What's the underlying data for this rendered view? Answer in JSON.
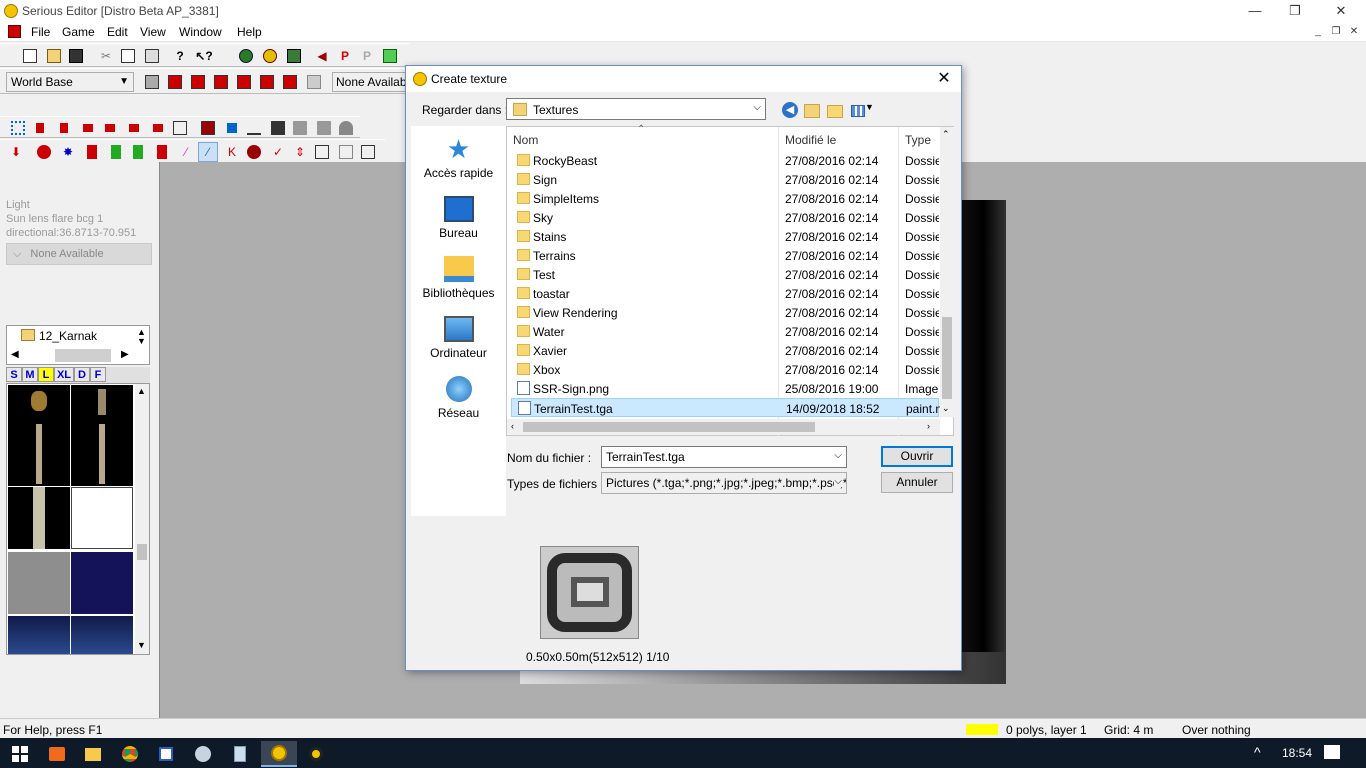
{
  "window": {
    "title": "Serious Editor [Distro Beta AP_3381]",
    "min": "—",
    "restore": "❐",
    "close": "✕"
  },
  "menu": {
    "items": [
      "File",
      "Game",
      "Edit",
      "View",
      "Window",
      "Help"
    ],
    "mdi_min": "_",
    "mdi_restore": "❐",
    "mdi_close": "✕"
  },
  "toolbar": {
    "world_base": "World Base",
    "none_available": "None Availabl"
  },
  "left_panel": {
    "line1": "Light",
    "line2": "Sun lens flare bcg 1",
    "line3": "directional:36.8713-70.951",
    "dropdown": "None Available",
    "tree_item": "12_Karnak",
    "tex_buttons": [
      "S",
      "M",
      "L",
      "XL",
      "D",
      "F"
    ]
  },
  "status_bar": {
    "help": "For Help, press F1",
    "polys": "0 polys, layer 1",
    "grid": "Grid: 4 m",
    "over": "Over nothing"
  },
  "taskbar": {
    "time": "18:54",
    "tray_up": "^"
  },
  "dialog": {
    "title": "Create texture",
    "close": "✕",
    "look_in_label": "Regarder dans :",
    "look_in_value": "Textures",
    "places": [
      "Accès rapide",
      "Bureau",
      "Bibliothèques",
      "Ordinateur",
      "Réseau"
    ],
    "columns": {
      "name": "Nom",
      "modified": "Modifié le",
      "type": "Type"
    },
    "files": [
      {
        "name": "RockyBeast",
        "date": "27/08/2016 02:14",
        "type": "Dossie",
        "kind": "folder"
      },
      {
        "name": "Sign",
        "date": "27/08/2016 02:14",
        "type": "Dossie",
        "kind": "folder"
      },
      {
        "name": "SimpleItems",
        "date": "27/08/2016 02:14",
        "type": "Dossie",
        "kind": "folder"
      },
      {
        "name": "Sky",
        "date": "27/08/2016 02:14",
        "type": "Dossie",
        "kind": "folder"
      },
      {
        "name": "Stains",
        "date": "27/08/2016 02:14",
        "type": "Dossie",
        "kind": "folder"
      },
      {
        "name": "Terrains",
        "date": "27/08/2016 02:14",
        "type": "Dossie",
        "kind": "folder"
      },
      {
        "name": "Test",
        "date": "27/08/2016 02:14",
        "type": "Dossie",
        "kind": "folder"
      },
      {
        "name": "toastar",
        "date": "27/08/2016 02:14",
        "type": "Dossie",
        "kind": "folder"
      },
      {
        "name": "View Rendering",
        "date": "27/08/2016 02:14",
        "type": "Dossie",
        "kind": "folder"
      },
      {
        "name": "Water",
        "date": "27/08/2016 02:14",
        "type": "Dossie",
        "kind": "folder"
      },
      {
        "name": "Xavier",
        "date": "27/08/2016 02:14",
        "type": "Dossie",
        "kind": "folder"
      },
      {
        "name": "Xbox",
        "date": "27/08/2016 02:14",
        "type": "Dossie",
        "kind": "folder"
      },
      {
        "name": "SSR-Sign.png",
        "date": "25/08/2016 19:00",
        "type": "Image",
        "kind": "image"
      },
      {
        "name": "TerrainTest.tga",
        "date": "14/09/2018 18:52",
        "type": "paint.n",
        "kind": "image",
        "selected": true
      }
    ],
    "filename_label": "Nom du fichier :",
    "filename_value": "TerrainTest.tga",
    "filetype_label": "Types de fichiers :",
    "filetype_value": "Pictures (*.tga;*.png;*.jpg;*.jpeg;*.bmp;*.psd;*.gi",
    "open_button": "Ouvrir",
    "cancel_button": "Annuler",
    "preview_caption": "0.50x0.50m(512x512) 1/10"
  }
}
